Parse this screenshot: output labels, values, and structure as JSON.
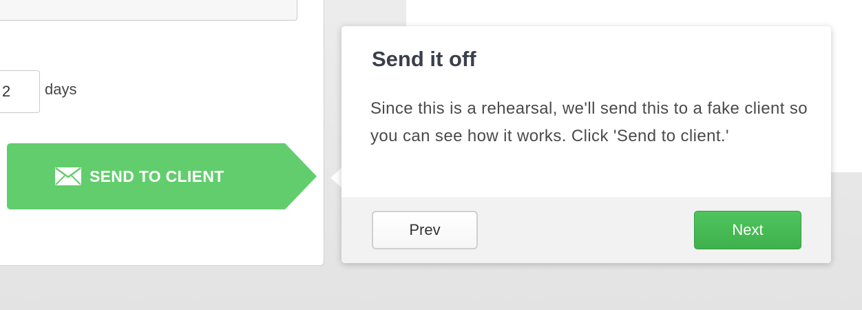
{
  "form": {
    "days_value": "2",
    "days_label": "days"
  },
  "send_button": {
    "label": "SEND TO CLIENT",
    "icon": "envelope-icon",
    "color": "#62cd6c"
  },
  "tour_popover": {
    "title": "Send it off",
    "body": "Since this is a rehearsal, we'll send this to a fake client so you can see how it works. Click 'Send to client.'",
    "prev_label": "Prev",
    "next_label": "Next",
    "next_color": "#45b852"
  }
}
